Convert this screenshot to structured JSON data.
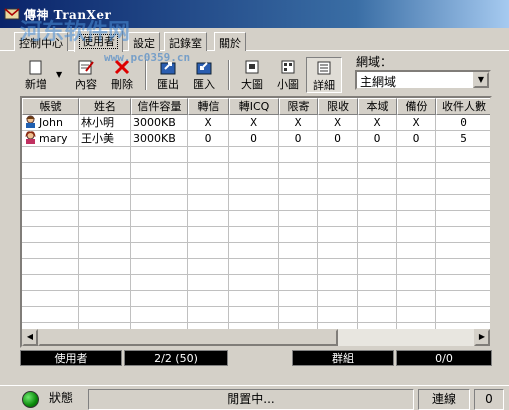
{
  "window": {
    "title": "傳神 TranXer"
  },
  "watermark": {
    "text": "河东软件网",
    "url": "www.pc0359.cn"
  },
  "tabs": [
    {
      "label": "控制中心"
    },
    {
      "label": "使用者"
    },
    {
      "label": "設定"
    },
    {
      "label": "記錄室"
    },
    {
      "label": "關於"
    }
  ],
  "toolbar": {
    "new": "新增",
    "props": "內容",
    "delete": "刪除",
    "export": "匯出",
    "import": "匯入",
    "large": "大圖",
    "small": "小圖",
    "detail": "詳細"
  },
  "domain": {
    "label": "網域：",
    "selected": "主網域"
  },
  "table": {
    "columns": [
      "帳號",
      "姓名",
      "信件容量",
      "轉信",
      "轉ICQ",
      "限寄",
      "限收",
      "本域",
      "備份",
      "收件人數"
    ],
    "rows": [
      [
        "John",
        "林小明",
        "3000KB",
        "X",
        "X",
        "X",
        "X",
        "X",
        "X",
        "0"
      ],
      [
        "mary",
        "王小美",
        "3000KB",
        "O",
        "O",
        "O",
        "O",
        "O",
        "O",
        "5"
      ]
    ]
  },
  "status_strip": {
    "users_label": "使用者",
    "users_count": "2/2 (50)",
    "group_label": "群組",
    "group_count": "0/0"
  },
  "bottom": {
    "status_label": "狀態",
    "idle": "閒置中...",
    "connect": "連線",
    "count": "0"
  },
  "colors": {
    "title_start": "#0a246a",
    "title_end": "#a6caf0",
    "face": "#d4d0c8",
    "led": "#0a8a0a"
  }
}
